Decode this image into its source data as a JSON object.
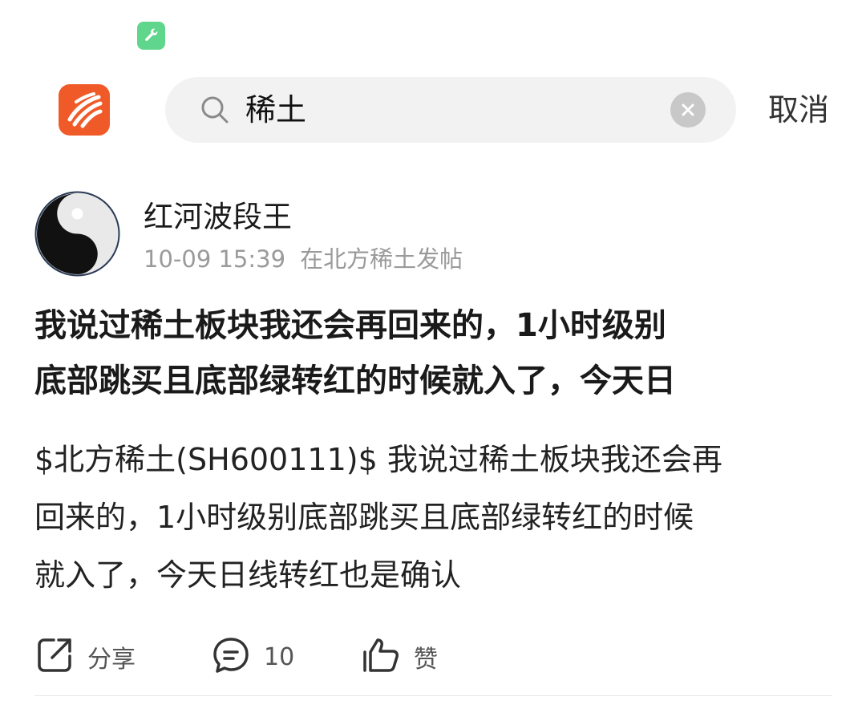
{
  "status_bar": {
    "icon": "wrench-icon",
    "color": "#5fd68b"
  },
  "header": {
    "logo": "app-logo",
    "search": {
      "query": "稀土",
      "icon": "search-icon",
      "clear_icon": "close-icon"
    },
    "cancel_label": "取消"
  },
  "post": {
    "author": "红河波段王",
    "time": "10-09 15:39",
    "location": "在北方稀土发帖",
    "title": "我说过稀土板块我还会再回来的，1小时级别\n底部跳买且底部绿转红的时候就入了，今天日",
    "body": "$北方稀土(SH600111)$ 我说过稀土板块我还会再\n回来的，1小时级别底部跳买且底部绿转红的时候\n就入了，今天日线转红也是确认",
    "actions": {
      "share_label": "分享",
      "comment_count": "10",
      "like_label": "赞"
    }
  },
  "colors": {
    "accent": "#f05a28",
    "muted": "#9a9a9a",
    "search_bg": "#f2f2f2"
  }
}
